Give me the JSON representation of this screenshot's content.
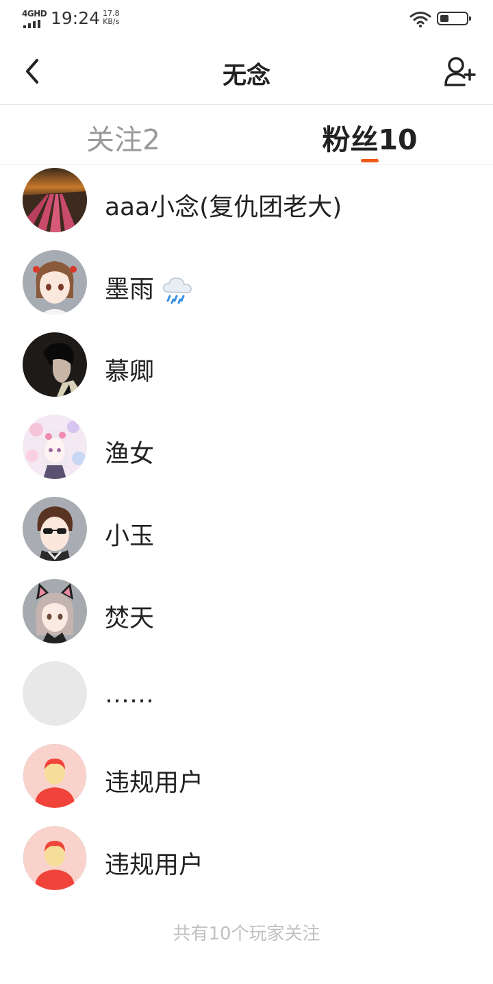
{
  "status_bar": {
    "network": "4GHD",
    "time": "19:24",
    "speed_value": "17.8",
    "speed_unit": "KB/s",
    "battery_level": 0.3
  },
  "nav": {
    "title": "无念",
    "back_icon": "chevron-left-icon",
    "action_icon": "add-user-icon"
  },
  "tabs": [
    {
      "label": "关注2",
      "active": false
    },
    {
      "label": "粉丝10",
      "active": true
    }
  ],
  "accent_color": "#f05a1a",
  "followers": [
    {
      "name": "aaa小念(复仇团老大)",
      "avatar": "tulip-field-sunset"
    },
    {
      "name": "墨雨",
      "avatar": "anime-girl-brown-hair",
      "emoji": "rain-cloud-icon"
    },
    {
      "name": "慕卿",
      "avatar": "dark-portrait-boy"
    },
    {
      "name": "渔女",
      "avatar": "anime-girl-pastel"
    },
    {
      "name": "小玉",
      "avatar": "anime-boy-sunglasses"
    },
    {
      "name": "焚天",
      "avatar": "anime-girl-cat-ears"
    },
    {
      "name": "……",
      "avatar": "empty-gray"
    },
    {
      "name": "违规用户",
      "avatar": "default-red-user"
    },
    {
      "name": "违规用户",
      "avatar": "default-red-user"
    }
  ],
  "footer": "共有10个玩家关注"
}
